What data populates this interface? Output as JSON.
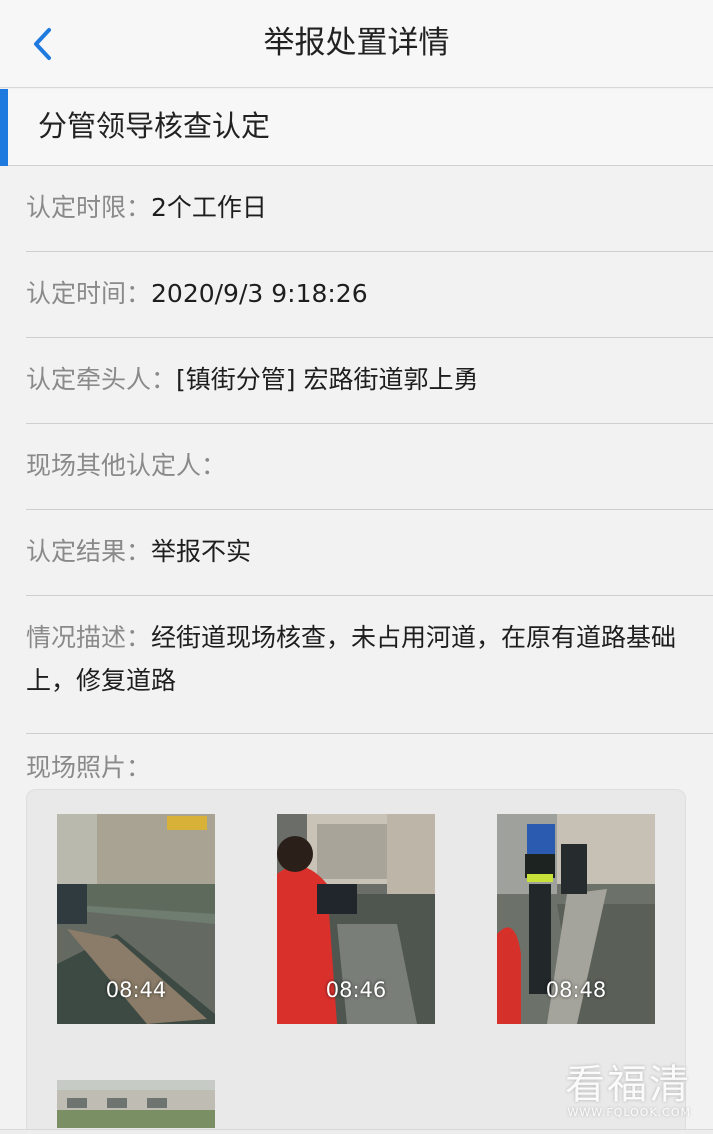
{
  "nav": {
    "title": "举报处置详情"
  },
  "section": {
    "title": "分管领导核查认定"
  },
  "fields": {
    "limit": {
      "label": "认定时限：",
      "value": "2个工作日"
    },
    "time": {
      "label": "认定时间：",
      "value": "2020/9/3 9:18:26"
    },
    "lead": {
      "label": "认定牵头人：",
      "value": "[镇街分管] 宏路街道郭上勇"
    },
    "others": {
      "label": "现场其他认定人：",
      "value": ""
    },
    "result": {
      "label": "认定结果：",
      "value": "举报不实"
    },
    "desc": {
      "label": "情况描述：",
      "value": "经街道现场核查，未占用河道，在原有道路基础上，修复道路"
    }
  },
  "photos": {
    "label": "现场照片：",
    "items": [
      {
        "time": "08:44"
      },
      {
        "time": "08:46"
      },
      {
        "time": "08:48"
      },
      {
        "time": ""
      }
    ]
  },
  "watermark": {
    "main": "看福清",
    "sub": "WWW.FQLOOK.COM"
  },
  "colors": {
    "accent": "#1f7ae0",
    "label": "#8a8a8a"
  }
}
